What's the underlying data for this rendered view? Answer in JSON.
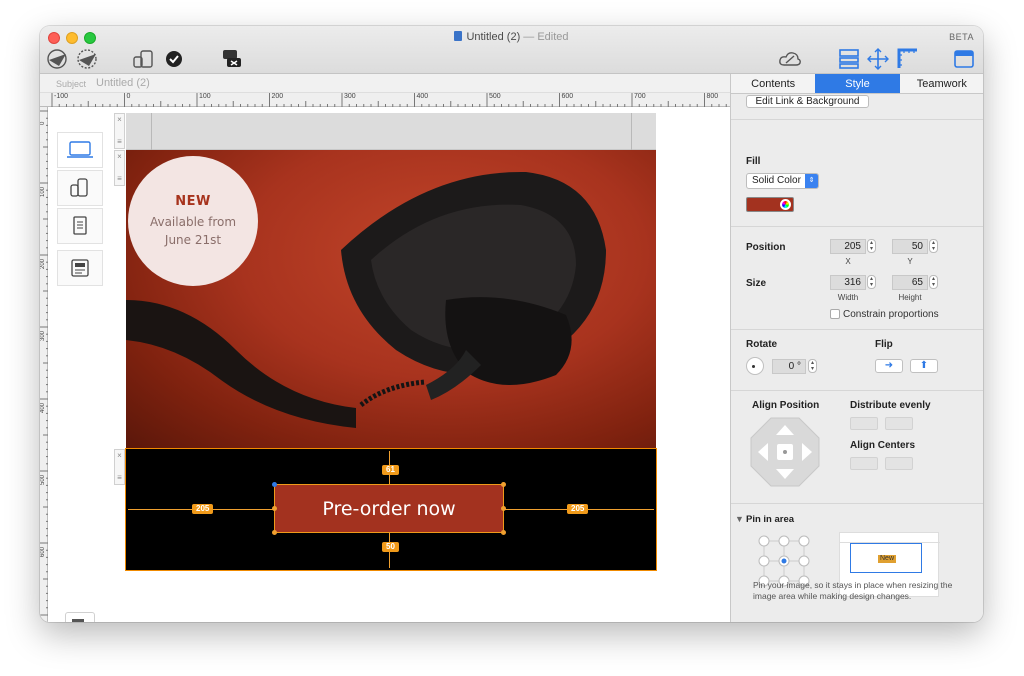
{
  "window": {
    "title": "Untitled (2)",
    "edited": " — Edited",
    "beta": "BETA"
  },
  "subject": {
    "label": "Subject",
    "value": "Untitled (2)"
  },
  "ruler": {
    "top_ticks": [
      "-100",
      "0",
      "100",
      "200",
      "300",
      "400",
      "500",
      "600",
      "700",
      "800"
    ],
    "left_ticks": [
      "0",
      "100",
      "200",
      "300",
      "400",
      "500",
      "600"
    ]
  },
  "canvas": {
    "badge": {
      "new": "NEW",
      "line1": "Available from",
      "line2": "June 21st"
    },
    "cta_label": "Pre-order now",
    "measure_top": "61",
    "measure_bottom": "50",
    "measure_left": "205",
    "measure_right": "205"
  },
  "panel": {
    "tabs": [
      "Contents",
      "Style",
      "Teamwork"
    ],
    "active_tab": "Style",
    "edit_link_button": "Edit Link & Background",
    "fill_label": "Fill",
    "fill_type": "Solid Color",
    "fill_color": "#a3321f",
    "position_label": "Position",
    "position_x": "205",
    "position_y": "50",
    "x_label": "X",
    "y_label": "Y",
    "size_label": "Size",
    "size_width": "316",
    "size_height": "65",
    "width_label": "Width",
    "height_label": "Height",
    "constrain_label": "Constrain proportions",
    "rotate_label": "Rotate",
    "rotate_value": "0 °",
    "flip_label": "Flip",
    "align_position_label": "Align Position",
    "distribute_label": "Distribute evenly",
    "align_centers_label": "Align Centers",
    "pin_label": "Pin in area",
    "pin_preview_badge": "New",
    "pin_note": "Pin your image, so it stays in place when resizing the image area while making design changes."
  },
  "colors": {
    "accent": "#2f7ae5",
    "guide": "#f09a1a",
    "cta": "#a3321f"
  }
}
